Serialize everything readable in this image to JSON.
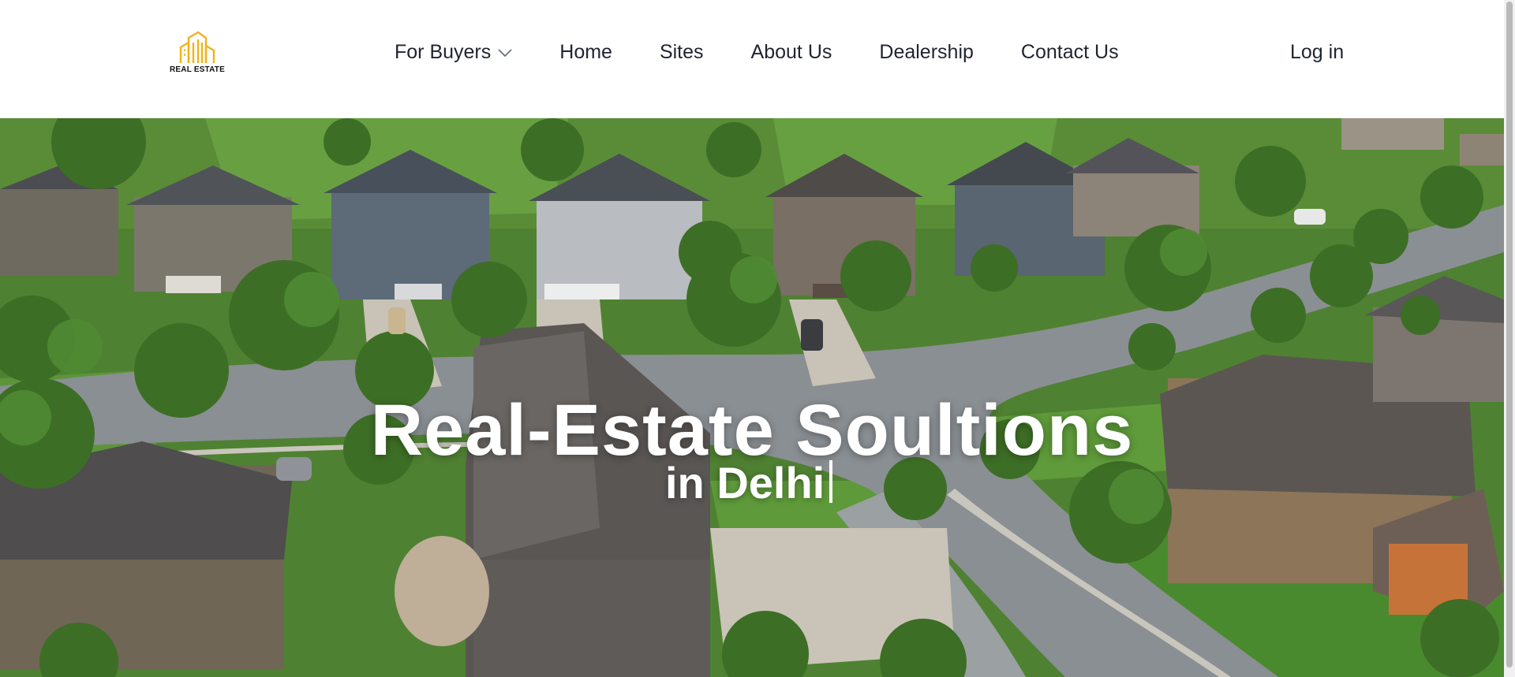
{
  "brand": {
    "logo_text": "REAL ESTATE",
    "accent_color": "#f2b21b"
  },
  "nav": {
    "items": [
      {
        "label": "For Buyers",
        "has_dropdown": true
      },
      {
        "label": "Home"
      },
      {
        "label": "Sites"
      },
      {
        "label": "About Us"
      },
      {
        "label": "Dealership"
      },
      {
        "label": "Contact Us"
      }
    ],
    "login_label": "Log in"
  },
  "hero": {
    "title": "Real-Estate Soultions",
    "subtitle": "in Delhi"
  },
  "icons": {
    "logo": "building-icon",
    "dropdown": "chevron-down-icon"
  }
}
